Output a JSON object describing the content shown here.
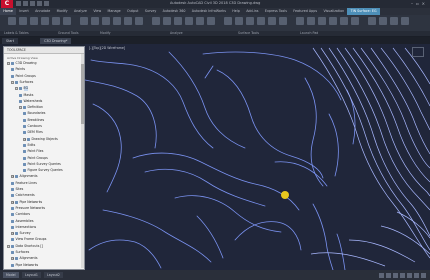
{
  "window": {
    "title": "Autodesk AutoCAD Civil 3D 2018   C3D Drawing.dwg"
  },
  "ribbon_tabs": [
    {
      "label": "Home"
    },
    {
      "label": "Insert"
    },
    {
      "label": "Annotate"
    },
    {
      "label": "Modify"
    },
    {
      "label": "Analyze"
    },
    {
      "label": "View"
    },
    {
      "label": "Manage"
    },
    {
      "label": "Output"
    },
    {
      "label": "Survey"
    },
    {
      "label": "Autodesk 360"
    },
    {
      "label": "Autodesk InfraWorks"
    },
    {
      "label": "Help"
    },
    {
      "label": "Add-ins"
    },
    {
      "label": "Express Tools"
    },
    {
      "label": "Featured Apps"
    },
    {
      "label": "Visualization"
    },
    {
      "label": "TIN Surface: EG"
    }
  ],
  "panel_labels": [
    "Labels & Tables",
    "Ground Tools",
    "Modify",
    "Analyze",
    "Surface Tools",
    "Launch Pad"
  ],
  "file_tabs": [
    "Start",
    "C3D Drawing*"
  ],
  "toolspace": {
    "header": "TOOLSPACE",
    "view": "Active Drawing View",
    "tree": [
      {
        "label": "C3D Drawing",
        "depth": 0,
        "expander": "-"
      },
      {
        "label": "Points",
        "depth": 1,
        "expander": ""
      },
      {
        "label": "Point Groups",
        "depth": 1,
        "expander": ""
      },
      {
        "label": "Surfaces",
        "depth": 1,
        "expander": "-"
      },
      {
        "label": "EG",
        "depth": 2,
        "expander": "-",
        "selected": true
      },
      {
        "label": "Masks",
        "depth": 3,
        "expander": ""
      },
      {
        "label": "Watersheds",
        "depth": 3,
        "expander": ""
      },
      {
        "label": "Definition",
        "depth": 3,
        "expander": "-"
      },
      {
        "label": "Boundaries",
        "depth": 4,
        "expander": ""
      },
      {
        "label": "Breaklines",
        "depth": 4,
        "expander": ""
      },
      {
        "label": "Contours",
        "depth": 4,
        "expander": ""
      },
      {
        "label": "DEM Files",
        "depth": 4,
        "expander": ""
      },
      {
        "label": "Drawing Objects",
        "depth": 4,
        "expander": "+"
      },
      {
        "label": "Edits",
        "depth": 4,
        "expander": ""
      },
      {
        "label": "Point Files",
        "depth": 4,
        "expander": ""
      },
      {
        "label": "Point Groups",
        "depth": 4,
        "expander": ""
      },
      {
        "label": "Point Survey Queries",
        "depth": 4,
        "expander": ""
      },
      {
        "label": "Figure Survey Queries",
        "depth": 4,
        "expander": ""
      },
      {
        "label": "Alignments",
        "depth": 1,
        "expander": "+"
      },
      {
        "label": "Feature Lines",
        "depth": 1,
        "expander": ""
      },
      {
        "label": "Sites",
        "depth": 1,
        "expander": ""
      },
      {
        "label": "Catchments",
        "depth": 1,
        "expander": ""
      },
      {
        "label": "Pipe Networks",
        "depth": 1,
        "expander": "+"
      },
      {
        "label": "Pressure Networks",
        "depth": 1,
        "expander": ""
      },
      {
        "label": "Corridors",
        "depth": 1,
        "expander": ""
      },
      {
        "label": "Assemblies",
        "depth": 1,
        "expander": ""
      },
      {
        "label": "Intersections",
        "depth": 1,
        "expander": ""
      },
      {
        "label": "Survey",
        "depth": 1,
        "expander": "+"
      },
      {
        "label": "View Frame Groups",
        "depth": 1,
        "expander": ""
      },
      {
        "label": "Data Shortcuts []",
        "depth": 0,
        "expander": "-"
      },
      {
        "label": "Surfaces",
        "depth": 1,
        "expander": ""
      },
      {
        "label": "Alignments",
        "depth": 1,
        "expander": "+"
      },
      {
        "label": "Pipe Networks",
        "depth": 1,
        "expander": ""
      }
    ]
  },
  "viewport": {
    "label": "[-][Top][2D Wireframe]"
  },
  "status_tabs": [
    "Model",
    "Layout1",
    "Layout2"
  ],
  "colors": {
    "contour": "#7b93f2",
    "contour_bright": "#a9b8ff",
    "background": "#20263a",
    "cursor": "#e8c81e"
  }
}
